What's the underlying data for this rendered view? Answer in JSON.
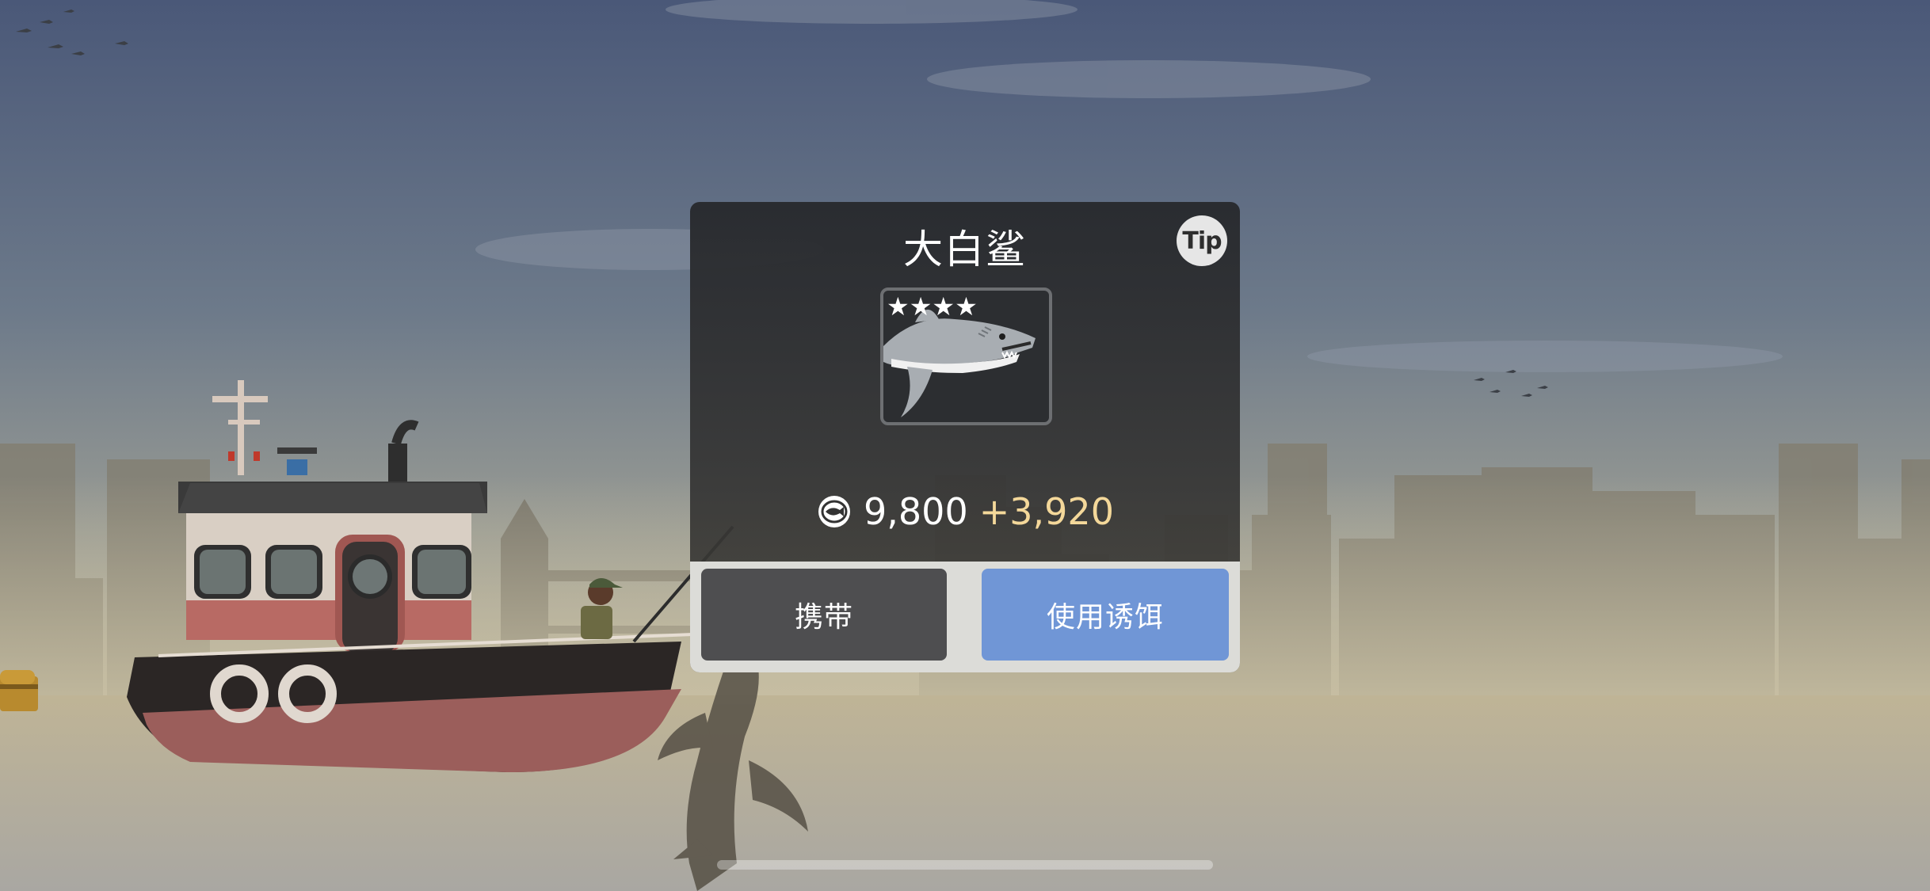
{
  "dialog": {
    "title": "大白鲨",
    "tip_label": "Tip",
    "rating_stars": 4,
    "stars_text": "★★★★",
    "price": "9,800",
    "bonus": "+3,920",
    "buttons": {
      "carry": "携带",
      "use_bait": "使用诱饵"
    },
    "icons": {
      "coin": "fish-coin-icon",
      "fish": "great-white-shark"
    }
  },
  "colors": {
    "bait_button": "#7096d6",
    "carry_button": "#4e4e50",
    "bonus_text": "#f4d89a"
  }
}
